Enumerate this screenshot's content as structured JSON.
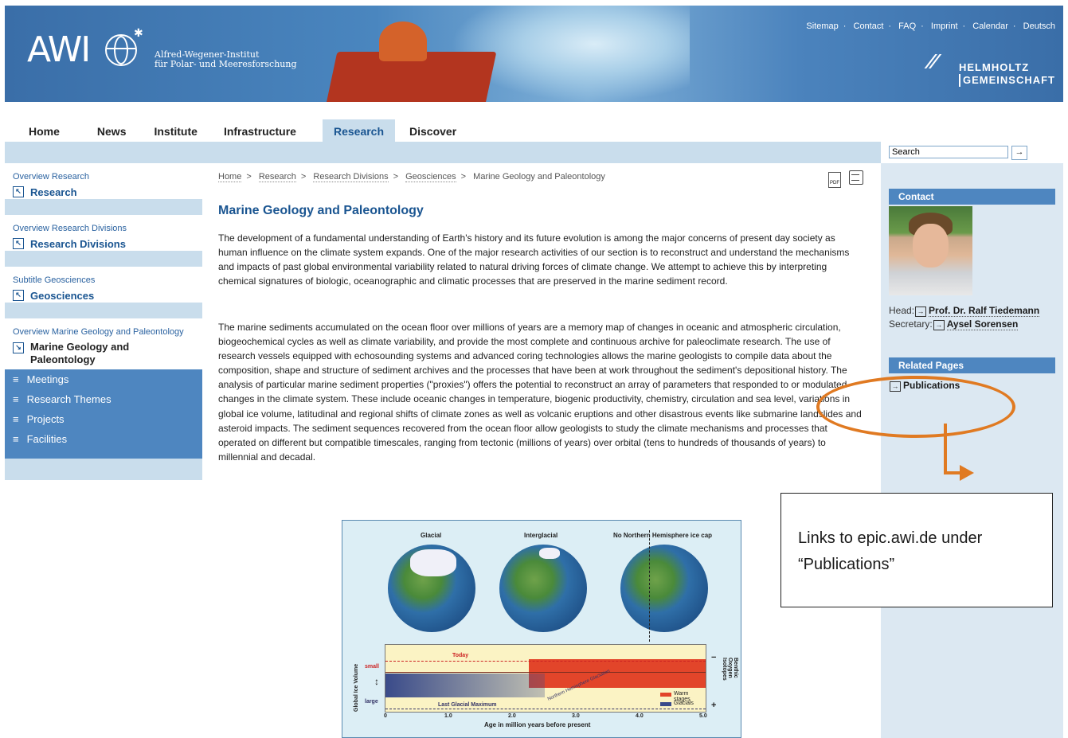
{
  "header": {
    "logo_text": "AWI",
    "logo_sub_1": "Alfred-Wegener-Institut",
    "logo_sub_2": "für Polar- und Meeresforschung",
    "top_links": [
      "Sitemap",
      "Contact",
      "FAQ",
      "Imprint",
      "Calendar",
      "Deutsch"
    ],
    "helmholtz_1": "HELMHOLTZ",
    "helmholtz_2": "GEMEINSCHAFT"
  },
  "main_nav": [
    "Home",
    "News",
    "Institute",
    "Infrastructure",
    "Research",
    "Discover"
  ],
  "search": {
    "placeholder": "Search",
    "go": "→"
  },
  "left_nav": {
    "groups": [
      {
        "overview": "Overview Research",
        "label": "Research"
      },
      {
        "overview": "Overview Research Divisions",
        "label": "Research Divisions"
      },
      {
        "overview": "Subtitle Geosciences",
        "label": "Geosciences"
      },
      {
        "overview": "Overview Marine Geology and Paleontology",
        "label": "Marine Geology and Paleontology"
      }
    ],
    "submenu": [
      "Meetings",
      "Research Themes",
      "Projects",
      "Facilities"
    ]
  },
  "breadcrumb": [
    "Home",
    "Research",
    "Research Divisions",
    "Geosciences",
    "Marine Geology and Paleontology"
  ],
  "page_title": "Marine Geology and Paleontology",
  "paragraphs": [
    "The development of a fundamental understanding of Earth's history and its future evolution is among the major concerns of present day society as human influence on the climate system expands. One of the major research activities of our section is to reconstruct and understand the mechanisms and impacts of past global environmental variability related to natural driving forces of climate change. We attempt to achieve this by interpreting chemical signatures of biologic, oceanographic and climatic processes that are preserved in the marine sediment record.",
    "The marine sediments accumulated on the ocean floor over millions of years are a memory map of changes in oceanic and atmospheric circulation, biogeochemical cycles as well as climate variability, and provide the most complete and continuous archive for paleoclimate research. The use of research vessels equipped with echosounding systems and advanced coring technologies allows the marine geologists to compile data about the composition, shape and structure of sediment archives and the processes that have been at work throughout the sediment's depositional history. The analysis of particular marine sediment properties (\"proxies\") offers the potential to reconstruct an array of parameters that responded to or modulated changes in the climate system. These include oceanic changes in temperature, biogenic productivity, chemistry, circulation and sea level, variations in global ice volume, latitudinal and regional shifts of climate zones as well as volcanic eruptions and other disastrous events like submarine landslides and asteroid impacts. The sediment sequences recovered from the ocean floor allow geologists to study the climate mechanisms and processes that operated on different but compatible timescales, ranging from tectonic (millions of years) over orbital (tens to hundreds of thousands of years) to millennial and decadal."
  ],
  "figure": {
    "globe_labels": [
      "Glacial",
      "Interglacial",
      "No Northern Hemisphere ice cap"
    ],
    "y_left": "Global Ice Volume",
    "small": "small",
    "large": "large",
    "today": "Today",
    "lgm": "Last Glacial Maximum",
    "nhg": "Northern Hemisphere Glaciation",
    "y_right": "Benthic Oxygen Isotopes",
    "minus": "−",
    "plus": "+",
    "legend_warm": "Warm stages",
    "legend_glacials": "Glacials",
    "x_ticks": [
      "0",
      "1.0",
      "2.0",
      "3.0",
      "4.0",
      "5.0"
    ],
    "x_label": "Age in million years before present"
  },
  "contact": {
    "heading": "Contact",
    "head_label": "Head:",
    "head_name": "Prof. Dr. Ralf Tiedemann",
    "secretary_label": "Secretary:",
    "secretary_name": "Aysel Sorensen"
  },
  "related": {
    "heading": "Related Pages",
    "link": "Publications"
  },
  "annotation": {
    "line1": "Links to epic.awi.de under",
    "line2": "“Publications”",
    "color": "#e07a22"
  }
}
